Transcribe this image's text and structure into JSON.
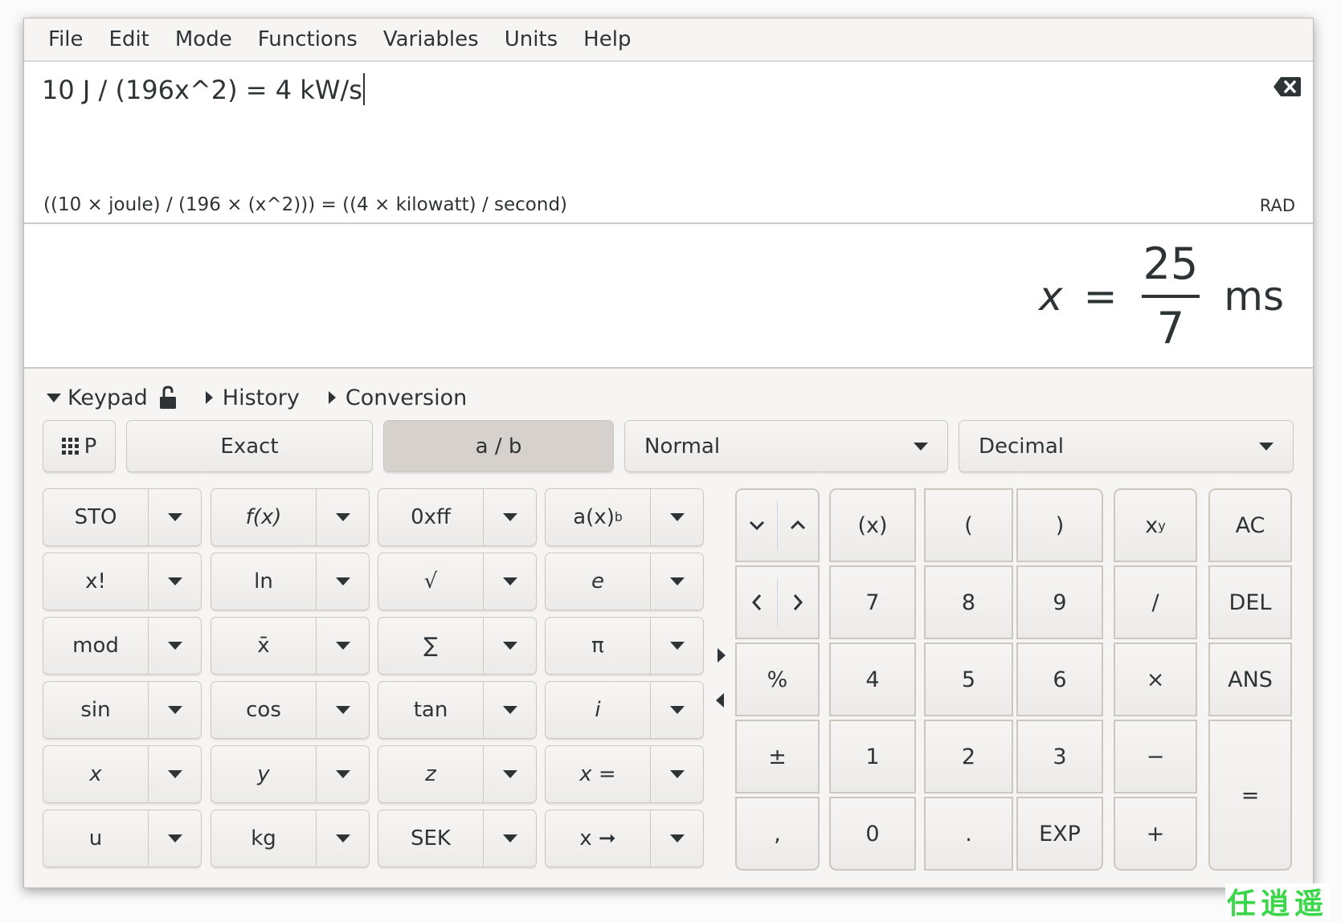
{
  "menu": [
    "File",
    "Edit",
    "Mode",
    "Functions",
    "Variables",
    "Units",
    "Help"
  ],
  "input": {
    "expression": "10 J / (196x^2) = 4 kW/s",
    "clear_icon": "backspace-clear-icon"
  },
  "parsed": {
    "text": "((10 × joule) / (196 × (x^2))) = ((4 × kilowatt) / second)",
    "angle_unit": "RAD"
  },
  "result": {
    "variable": "x",
    "equals": "=",
    "numerator": "25",
    "denominator": "7",
    "unit": "ms"
  },
  "sections": {
    "keypad": "Keypad",
    "history": "History",
    "conversion": "Conversion"
  },
  "toolbar": {
    "programming_label": "P",
    "exact_label": "Exact",
    "fraction_label": "a / b",
    "fraction_active": true,
    "number_format": "Normal",
    "base": "Decimal"
  },
  "functions": [
    [
      "STO",
      "f(x)",
      "0xff",
      "a(x)"
    ],
    [
      "x!",
      "ln",
      "√",
      "e"
    ],
    [
      "mod",
      "x̄",
      "∑",
      "π"
    ],
    [
      "sin",
      "cos",
      "tan",
      "i"
    ],
    [
      "x",
      "y",
      "z",
      "x ="
    ],
    [
      "u",
      "kg",
      "SEK",
      "x ➞"
    ]
  ],
  "function_sup": {
    "a(x)": "b"
  },
  "keypad": {
    "row1": [
      "(x)",
      "(",
      ")",
      "x",
      "AC"
    ],
    "xy_sup": "y",
    "row2": [
      "7",
      "8",
      "9",
      "/",
      "DEL"
    ],
    "row3": [
      "%",
      "4",
      "5",
      "6",
      "×",
      "ANS"
    ],
    "row4": [
      "±",
      "1",
      "2",
      "3",
      "−"
    ],
    "row5": [
      ",",
      "0",
      ".",
      "EXP",
      "+"
    ],
    "equals": "="
  },
  "watermark": "任逍遥"
}
